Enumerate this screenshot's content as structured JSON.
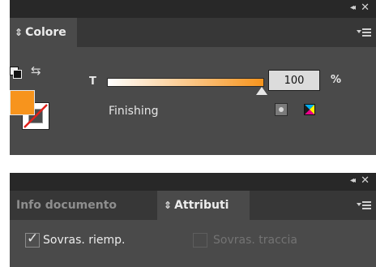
{
  "color_panel": {
    "tab_title": "Colore",
    "slider_label": "T",
    "tint_value": "100",
    "percent_symbol": "%",
    "tint_fraction": 1.0,
    "swatch_name": "Finishing",
    "fill_color": "#f7941d",
    "icons": [
      "collapse-icon",
      "close-icon",
      "panel-menu-icon",
      "default-fill-stroke-icon",
      "swap-fill-stroke-icon",
      "spot-color-icon",
      "cmyk-icon"
    ]
  },
  "attributes_panel": {
    "tabs": [
      {
        "label": "Info documento",
        "active": false
      },
      {
        "label": "Attributi",
        "active": true
      }
    ],
    "overprint_fill": {
      "label": "Sovras. riemp.",
      "checked": true
    },
    "overprint_stroke": {
      "label": "Sovras. traccia",
      "checked": false
    }
  },
  "window_controls": {
    "collapse_glyph": "◂◂",
    "close_glyph": "✕"
  }
}
